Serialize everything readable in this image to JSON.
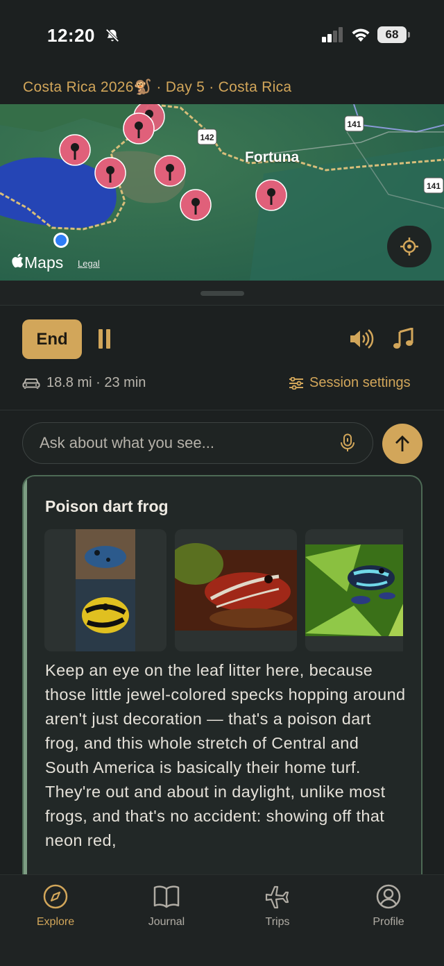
{
  "status": {
    "time": "12:20",
    "battery": "68",
    "bell_icon": "bell-slash-icon",
    "cellular_icon": "cellular-icon",
    "wifi_icon": "wifi-icon"
  },
  "trip": {
    "header": "Costa Rica 2026🐒 · Day 5 · Costa Rica"
  },
  "map": {
    "place_label": "Fortuna",
    "route_badges": [
      "142",
      "141",
      "141"
    ],
    "attribution": "Maps",
    "legal_link": "Legal",
    "locate_icon": "crosshair-icon"
  },
  "controls": {
    "end_label": "End",
    "pause_icon": "pause-icon",
    "volume_icon": "speaker-icon",
    "music_icon": "music-note-icon",
    "stats": "18.8 mi · 23 min",
    "session_settings_label": "Session settings"
  },
  "ask": {
    "placeholder": "Ask about what you see...",
    "mic_icon": "microphone-icon",
    "send_icon": "arrow-up-icon"
  },
  "card": {
    "title": "Poison dart frog",
    "body": "Keep an eye on the leaf litter here, because those little jewel-colored specks hopping around aren't just decoration — that's a poison dart frog, and this whole stretch of Central and South America is basically their home turf. They're out and about in daylight, unlike most frogs, and that's no accident: showing off that neon red,"
  },
  "tabs": [
    {
      "label": "Explore",
      "icon": "compass-icon",
      "active": true
    },
    {
      "label": "Journal",
      "icon": "book-icon",
      "active": false
    },
    {
      "label": "Trips",
      "icon": "airplane-icon",
      "active": false
    },
    {
      "label": "Profile",
      "icon": "user-circle-icon",
      "active": false
    }
  ],
  "colors": {
    "accent": "#d2a65a",
    "background": "#1c2020",
    "card_border": "#7d9d83",
    "map_pin": "#e0607a"
  }
}
